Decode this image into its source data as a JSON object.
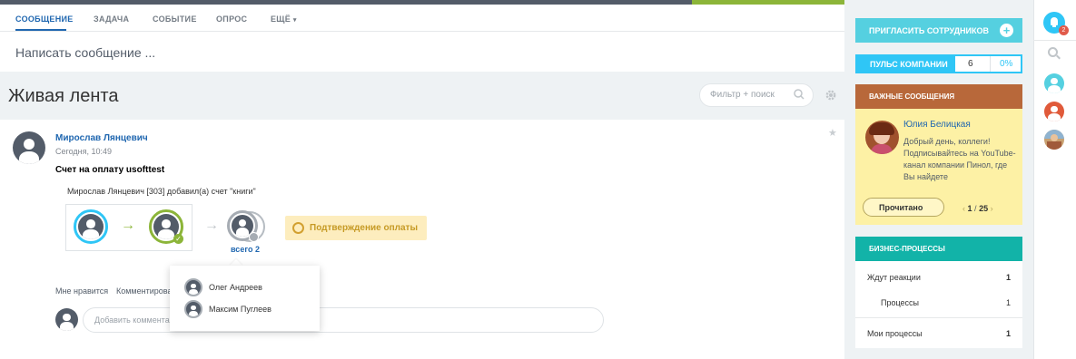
{
  "tabs": [
    {
      "label": "СООБЩЕНИЕ",
      "active": true
    },
    {
      "label": "ЗАДАЧА",
      "active": false
    },
    {
      "label": "СОБЫТИЕ",
      "active": false
    },
    {
      "label": "ОПРОС",
      "active": false
    },
    {
      "label": "ЕЩЁ",
      "active": false
    }
  ],
  "composer": {
    "placeholder": "Написать сообщение ..."
  },
  "feed": {
    "title": "Живая лента",
    "filter_placeholder": "Фильтр + поиск"
  },
  "post": {
    "author": "Мирослав Лянцевич",
    "time": "Сегодня, 10:49",
    "title": "Счет на оплату usofttest",
    "description": "Мирослав Лянцевич [303] добавил(а) счет \"книги\"",
    "total_label": "всего 2",
    "status": "Подтверждение оплаты",
    "actions": {
      "like": "Мне нравится",
      "comment": "Комментировать"
    },
    "comment_placeholder": "Добавить комментарий",
    "popup_people": [
      "Олег Андреев",
      "Максим Пуглеев"
    ]
  },
  "sidebar": {
    "invite_label": "ПРИГЛАСИТЬ СОТРУДНИКОВ",
    "pulse": {
      "label": "ПУЛЬС КОМПАНИИ",
      "value": "6",
      "percent": "0%"
    },
    "important": {
      "title": "ВАЖНЫЕ СООБЩЕНИЯ",
      "author": "Юлия Белицкая",
      "text": "Добрый день, коллеги! Подписывайтесь на YouTube-канал компании Пинол, где Вы найдете",
      "read_label": "Прочитано",
      "page_current": "1",
      "page_total": "25"
    },
    "business_processes": {
      "title": "БИЗНЕС-ПРОЦЕССЫ",
      "rows": [
        {
          "label": "Ждут реакции",
          "count": "1"
        },
        {
          "label": "Процессы",
          "count": "1"
        },
        {
          "label": "Мои процессы",
          "count": "1"
        }
      ]
    }
  },
  "rail": {
    "notifications": "2"
  },
  "colors": {
    "accent": "#2067b0",
    "invite": "#55d0e0",
    "pulse": "#2fc6f6",
    "important": "#b8683a",
    "bp": "#12b3a8"
  }
}
